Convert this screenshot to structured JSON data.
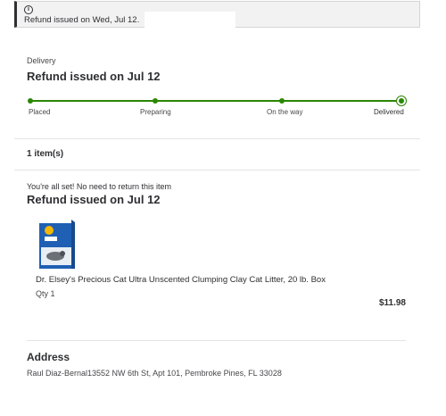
{
  "banner": {
    "icon": "info-circle-icon",
    "message": "Refund issued on Wed, Jul 12."
  },
  "delivery": {
    "label": "Delivery",
    "title": "Refund issued on Jul 12",
    "steps": [
      "Placed",
      "Preparing",
      "On the way",
      "Delivered"
    ],
    "accent": "#2a8703"
  },
  "items": {
    "count": "1 item(s)",
    "note": "You're all set! No need to return this item",
    "title": "Refund issued on Jul 12",
    "product": {
      "name": "Dr. Elsey's Precious Cat Ultra Unscented Clumping Clay Cat Litter, 20 lb. Box",
      "qty": "Qty 1",
      "price": "$11.98",
      "image_icon": "cat-litter-box-product-image"
    }
  },
  "address": {
    "title": "Address",
    "line": "Raul Diaz-Bernal13552 NW 6th St, Apt 101, Pembroke Pines, FL 33028"
  }
}
